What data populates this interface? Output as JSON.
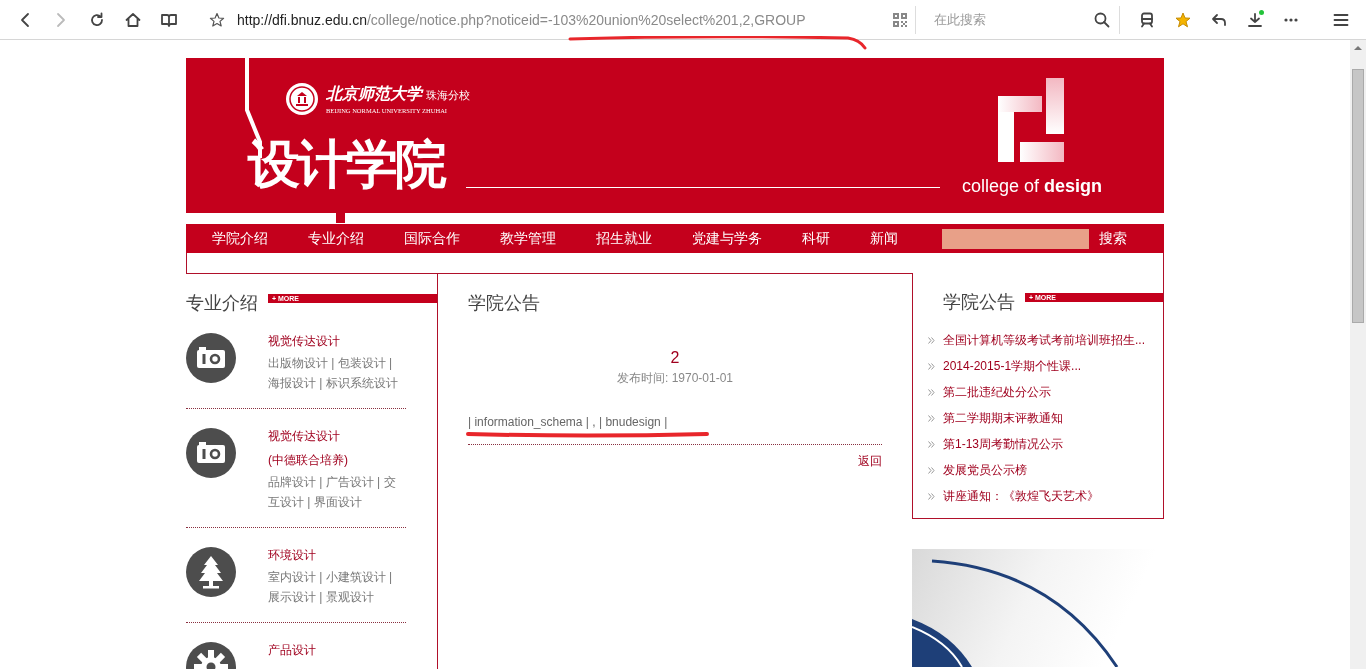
{
  "browser": {
    "nav_buttons": [
      {
        "kind": "back",
        "disabled": false
      },
      {
        "kind": "forward",
        "disabled": true
      },
      {
        "kind": "reload",
        "disabled": false
      },
      {
        "kind": "home",
        "disabled": false
      },
      {
        "kind": "reader",
        "disabled": false
      }
    ],
    "address": {
      "host": "http://dfi.bnuz.edu.cn",
      "path": "/college/notice.php?noticeid=-103%20union%20select%201,2,GROUP"
    },
    "search": {
      "placeholder": "在此搜索"
    },
    "toolbar_icons": [
      {
        "kind": "train",
        "badge": false
      },
      {
        "kind": "star",
        "badge": false
      },
      {
        "kind": "undo",
        "badge": false
      },
      {
        "kind": "download",
        "badge": true
      },
      {
        "kind": "more",
        "badge": false
      },
      {
        "kind": "menu",
        "badge": false
      }
    ]
  },
  "header": {
    "school_name": "北京师范大学",
    "campus": "珠海分校",
    "school_name_en": "BEIJING NORMAL UNIVERSITY ZHUHAI",
    "college_title": "设计学院",
    "college_en": "college of **design**"
  },
  "nav": {
    "items": [
      "学院介绍",
      "专业介绍",
      "国际合作",
      "教学管理",
      "招生就业",
      "党建与学务",
      "科研",
      "新闻"
    ],
    "search_button": "搜索"
  },
  "majors": {
    "heading": "专业介绍",
    "more": "+ MORE",
    "items": [
      {
        "kind": "camera",
        "titles": [
          "视觉传达设计"
        ],
        "description": "出版物设计 | 包装设计 | 海报设计 | 标识系统设计"
      },
      {
        "kind": "camera",
        "titles": [
          "视觉传达设计",
          "(中德联合培养)"
        ],
        "description": "品牌设计 | 广告设计 | 交互设计 | 界面设计"
      },
      {
        "kind": "tree",
        "titles": [
          "环境设计"
        ],
        "description": "室内设计 | 小建筑设计 | 展示设计 | 景观设计"
      },
      {
        "kind": "gear",
        "titles": [
          "产品设计"
        ]
      }
    ]
  },
  "notice": {
    "heading": "学院公告",
    "title": "2",
    "date": "发布时间: 1970-01-01",
    "body": "| information_schema | , | bnudesign |",
    "back_link": "返回"
  },
  "announcements": {
    "heading": "学院公告",
    "more": "+ MORE",
    "items": [
      "全国计算机等级考试考前培训班招生...",
      "2014-2015-1学期个性课...",
      "第二批违纪处分公示",
      "第二学期期末评教通知",
      "第1-13周考勤情况公示",
      "发展党员公示榜",
      "讲座通知：《敦煌飞天艺术》"
    ]
  }
}
